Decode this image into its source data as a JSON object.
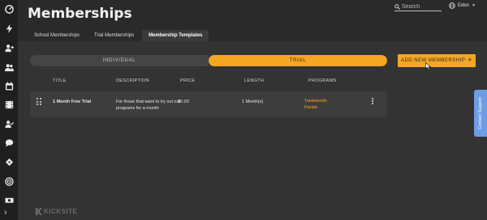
{
  "page": {
    "title": "Memberships"
  },
  "header": {
    "search_placeholder": "Search",
    "user_name": "Eden"
  },
  "tabs": [
    {
      "label": "School Memberships"
    },
    {
      "label": "Trial Memberships"
    },
    {
      "label": "Membership Templates",
      "active": true
    }
  ],
  "toggle": {
    "left": "INDIVIDUAL",
    "right": "TRIAL",
    "selected": "TRIAL"
  },
  "actions": {
    "add_label": "ADD NEW MEMBERSHIP"
  },
  "table": {
    "headers": [
      "TITLE",
      "DESCRIPTION",
      "PRICE",
      "LENGTH",
      "PROGRAMS"
    ],
    "rows": [
      {
        "title": "1 Month Free Trial",
        "description": "For those that want to try out our programs for a month",
        "price": "$0.00",
        "length": "1 Month(s)",
        "programs": [
          "Taekwondo",
          "Karate"
        ]
      }
    ]
  },
  "support": {
    "label": "Contact Support"
  },
  "footer": {
    "logo_text": "KICKSITE"
  },
  "sidebar": {
    "icons": [
      "dashboard-icon",
      "lightning-icon",
      "add-user-icon",
      "users-icon",
      "calendar-icon",
      "film-icon",
      "user-check-icon",
      "chat-icon",
      "ticket-icon",
      "target-icon",
      "money-icon",
      "expand-icon"
    ]
  },
  "colors": {
    "accent": "#f5a623",
    "support": "#6d9de6",
    "background": "#2a2a2a",
    "sidebar": "#1f1f1f"
  }
}
